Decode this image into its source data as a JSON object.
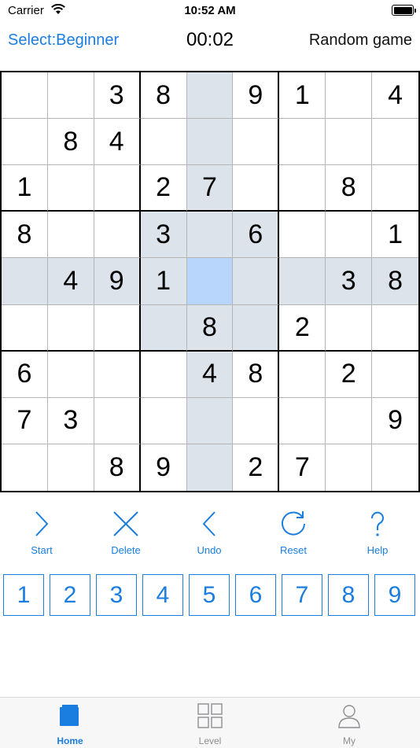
{
  "status_bar": {
    "carrier": "Carrier",
    "time": "10:52 AM"
  },
  "header": {
    "level": "Select:Beginner",
    "timer": "00:02",
    "random": "Random game"
  },
  "board": {
    "rows": [
      [
        "",
        "",
        "3",
        "8",
        "",
        "9",
        "1",
        "",
        "4"
      ],
      [
        "",
        "8",
        "4",
        "",
        "",
        "",
        "",
        "",
        ""
      ],
      [
        "1",
        "",
        "",
        "2",
        "7",
        "",
        "",
        "8",
        ""
      ],
      [
        "8",
        "",
        "",
        "3",
        "",
        "6",
        "",
        "",
        "1"
      ],
      [
        "",
        "4",
        "9",
        "1",
        "",
        "",
        "",
        "3",
        "8"
      ],
      [
        "",
        "",
        "",
        "",
        "8",
        "",
        "2",
        "",
        ""
      ],
      [
        "6",
        "",
        "",
        "",
        "4",
        "8",
        "",
        "2",
        ""
      ],
      [
        "7",
        "3",
        "",
        "",
        "",
        "",
        "",
        "",
        "9"
      ],
      [
        "",
        "",
        "8",
        "9",
        "",
        "2",
        "7",
        "",
        ""
      ]
    ],
    "selected": [
      4,
      4
    ]
  },
  "toolbar": [
    {
      "label": "Start",
      "icon": "chevron-right-icon"
    },
    {
      "label": "Delete",
      "icon": "x-icon"
    },
    {
      "label": "Undo",
      "icon": "chevron-left-icon"
    },
    {
      "label": "Reset",
      "icon": "refresh-icon"
    },
    {
      "label": "Help",
      "icon": "question-icon"
    }
  ],
  "numpad": [
    "1",
    "2",
    "3",
    "4",
    "5",
    "6",
    "7",
    "8",
    "9"
  ],
  "tabs": [
    {
      "label": "Home",
      "icon": "home-icon",
      "active": true
    },
    {
      "label": "Level",
      "icon": "grid-icon",
      "active": false
    },
    {
      "label": "My",
      "icon": "person-icon",
      "active": false
    }
  ],
  "colors": {
    "accent": "#1a7de0",
    "highlight": "#dde3ea",
    "selected": "#b8d5fb",
    "inactive_tab": "#8e8e93"
  }
}
